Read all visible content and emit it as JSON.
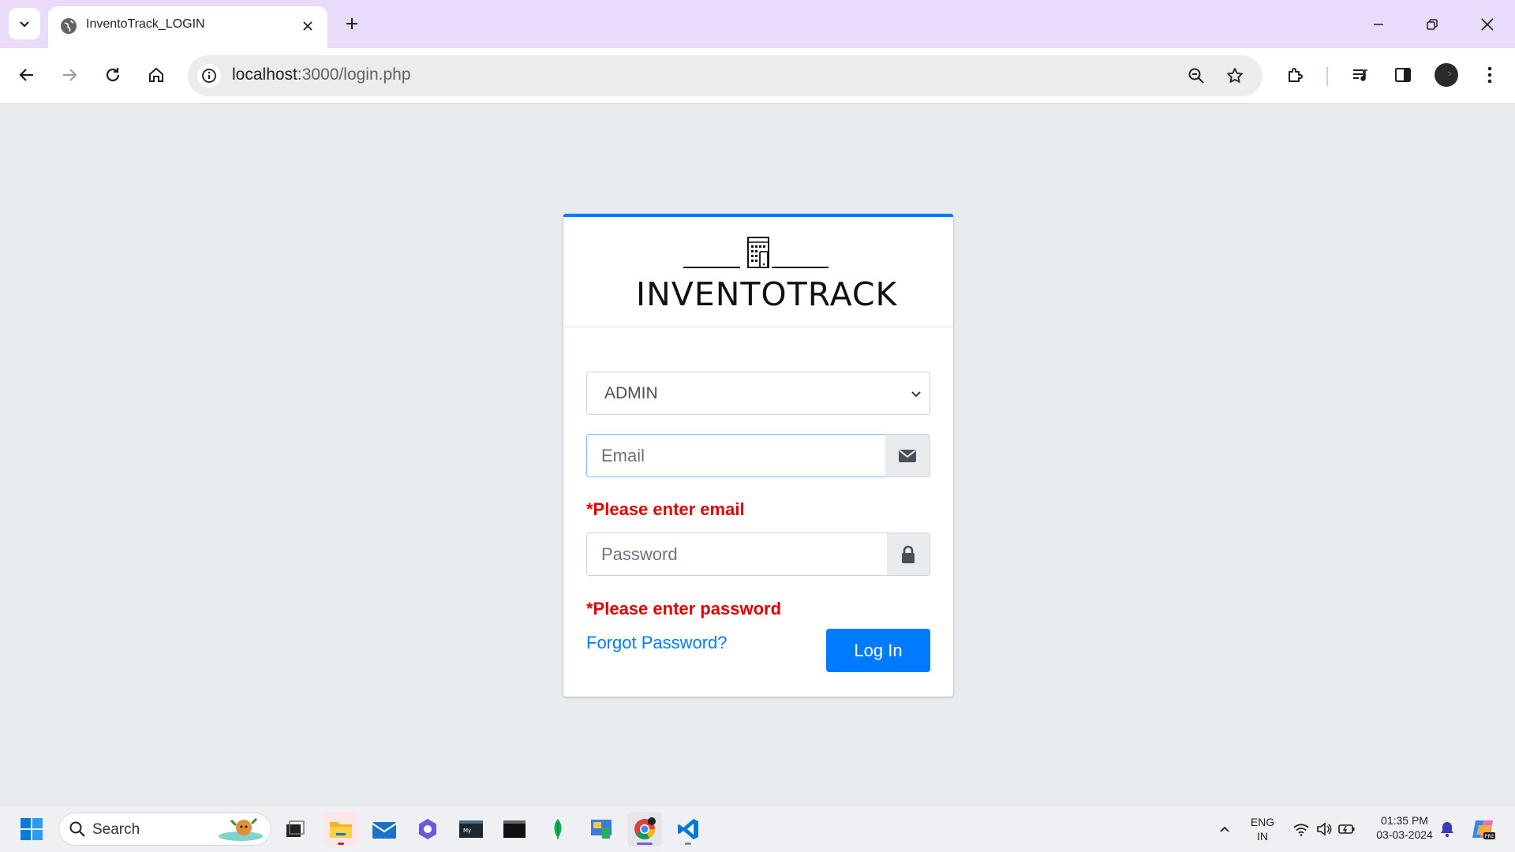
{
  "browser": {
    "tab_title": "InventoTrack_LOGIN",
    "url_host": "localhost",
    "url_path": ":3000/login.php"
  },
  "page": {
    "logo_text": "INVENTOTRACK",
    "role_select": {
      "value": "ADMIN",
      "options": [
        "ADMIN"
      ]
    },
    "email": {
      "placeholder": "Email",
      "value": "",
      "error": "*Please enter email"
    },
    "password": {
      "placeholder": "Password",
      "value": "",
      "error": "*Please enter password"
    },
    "forgot_link": "Forgot Password?",
    "login_button": "Log In",
    "colors": {
      "primary": "#007bff",
      "error": "#e00000",
      "background": "#e9ecef"
    }
  },
  "taskbar": {
    "search_label": "Search",
    "language": "ENG",
    "region": "IN",
    "time": "01:35 PM",
    "date": "03-03-2024"
  }
}
